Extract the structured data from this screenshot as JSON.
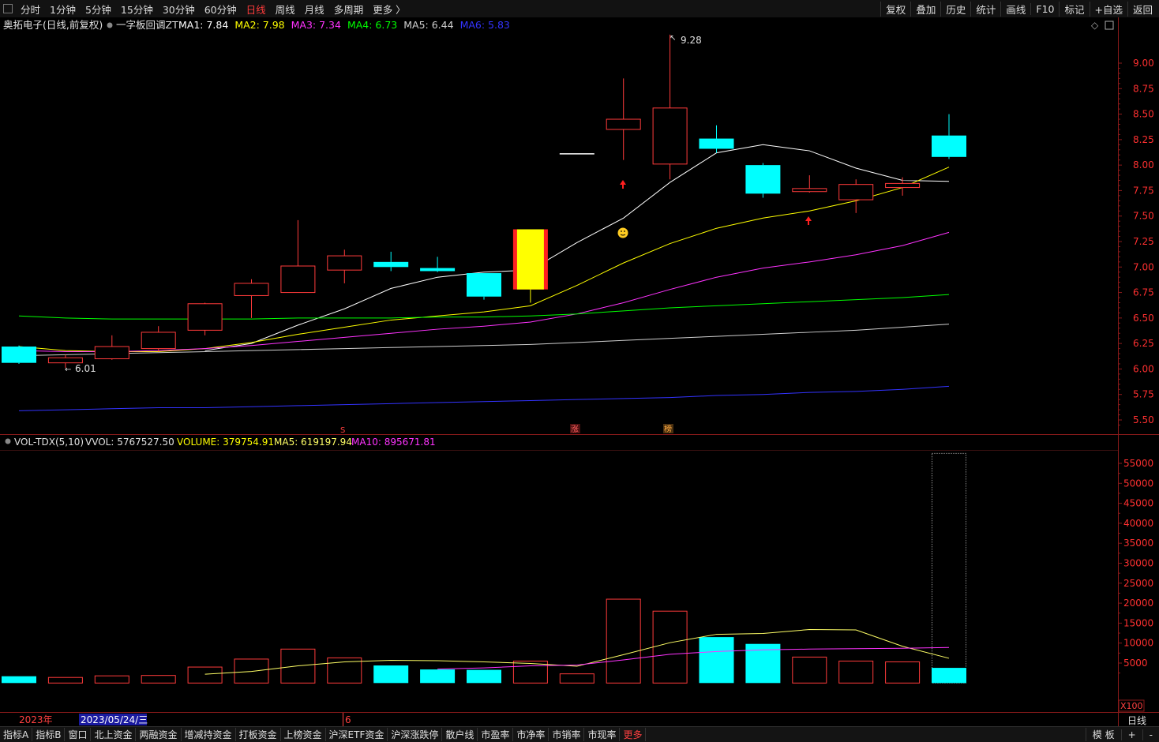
{
  "toolbar": {
    "periods": [
      "分时",
      "1分钟",
      "5分钟",
      "15分钟",
      "30分钟",
      "60分钟",
      "日线",
      "周线",
      "月线",
      "多周期",
      "更多 〉"
    ],
    "active_period": "日线",
    "right": [
      "复权",
      "叠加",
      "历史",
      "统计",
      "画线",
      "F10",
      "标记",
      "+自选",
      "返回"
    ]
  },
  "header": {
    "stock": "奥拓电子(日线,前复权)",
    "indicator": "一字板回调ZT",
    "ma": [
      {
        "label": "MA1: 7.84",
        "color": "#ffffff"
      },
      {
        "label": "MA2: 7.98",
        "color": "#ffff00"
      },
      {
        "label": "MA3: 7.34",
        "color": "#ff33ff"
      },
      {
        "label": "MA4: 6.73",
        "color": "#00ff00"
      },
      {
        "label": "MA5: 6.44",
        "color": "#cfcfcf"
      },
      {
        "label": "MA6: 5.83",
        "color": "#3333ff"
      }
    ]
  },
  "vol_header": {
    "name": "VOL-TDX(5,10)",
    "vvol": "VVOL: 5767527.50",
    "volume": "VOLUME: 379754.91",
    "ma5": "MA5: 619197.94",
    "ma10": "MA10: 895671.81"
  },
  "price_axis": [
    "9.00",
    "8.75",
    "8.50",
    "8.25",
    "8.00",
    "7.75",
    "7.50",
    "7.25",
    "7.00",
    "6.75",
    "6.50",
    "6.25",
    "6.00",
    "5.75",
    "5.50"
  ],
  "vol_axis": [
    "55000",
    "50000",
    "45000",
    "40000",
    "35000",
    "30000",
    "25000",
    "20000",
    "15000",
    "10000",
    "5000"
  ],
  "vol_unit": "X100",
  "period_label": "日线",
  "date_axis": {
    "year": "2023年",
    "cursor": "2023/05/24/三",
    "month": "6"
  },
  "annotations": {
    "high": "9.28",
    "low": "6.01",
    "marker_s": "S",
    "marker_zhang": "涨",
    "marker_bang": "榜"
  },
  "chart_data": {
    "type": "candlestick",
    "candles": [
      {
        "o": 6.22,
        "h": 6.23,
        "l": 6.05,
        "c": 6.06,
        "v": 1700
      },
      {
        "o": 6.06,
        "h": 6.14,
        "l": 6.01,
        "c": 6.11,
        "v": 1400
      },
      {
        "o": 6.1,
        "h": 6.33,
        "l": 6.09,
        "c": 6.22,
        "v": 1800
      },
      {
        "o": 6.2,
        "h": 6.42,
        "l": 6.17,
        "c": 6.36,
        "v": 1900
      },
      {
        "o": 6.38,
        "h": 6.65,
        "l": 6.33,
        "c": 6.64,
        "v": 4000
      },
      {
        "o": 6.72,
        "h": 6.88,
        "l": 6.5,
        "c": 6.84,
        "v": 6000
      },
      {
        "o": 6.75,
        "h": 7.46,
        "l": 6.75,
        "c": 7.01,
        "v": 8500
      },
      {
        "o": 6.97,
        "h": 7.17,
        "l": 6.84,
        "c": 7.11,
        "v": 6300
      },
      {
        "o": 7.05,
        "h": 7.15,
        "l": 6.96,
        "c": 7.0,
        "v": 4400
      },
      {
        "o": 6.99,
        "h": 7.1,
        "l": 6.95,
        "c": 6.96,
        "v": 3400
      },
      {
        "o": 6.94,
        "h": 6.94,
        "l": 6.68,
        "c": 6.71,
        "v": 3300
      },
      {
        "o": 6.78,
        "h": 7.37,
        "l": 6.65,
        "c": 7.37,
        "v": 5500,
        "limit": true
      },
      {
        "o": 8.11,
        "h": 8.11,
        "l": 8.11,
        "c": 8.11,
        "v": 2300
      },
      {
        "o": 8.35,
        "h": 8.85,
        "l": 8.05,
        "c": 8.45,
        "v": 21000
      },
      {
        "o": 8.01,
        "h": 9.28,
        "l": 7.86,
        "c": 8.56,
        "v": 18000
      },
      {
        "o": 8.26,
        "h": 8.39,
        "l": 8.12,
        "c": 8.16,
        "v": 11500
      },
      {
        "o": 8.0,
        "h": 8.02,
        "l": 7.68,
        "c": 7.72,
        "v": 9800
      },
      {
        "o": 7.74,
        "h": 7.9,
        "l": 7.73,
        "c": 7.77,
        "v": 6500
      },
      {
        "o": 7.66,
        "h": 7.86,
        "l": 7.53,
        "c": 7.81,
        "v": 5500
      },
      {
        "o": 7.78,
        "h": 7.88,
        "l": 7.7,
        "c": 7.82,
        "v": 5300
      },
      {
        "o": 8.29,
        "h": 8.5,
        "l": 8.06,
        "c": 8.08,
        "v": 3800,
        "vol_outline": 57500
      }
    ],
    "ma_lines": [
      {
        "name": "MA1",
        "color": "#ffffff",
        "values": [
          null,
          null,
          null,
          null,
          6.18,
          6.25,
          6.43,
          6.59,
          6.79,
          6.9,
          6.95,
          6.97,
          7.24,
          7.48,
          7.83,
          8.12,
          8.2,
          8.14,
          7.97,
          7.85,
          7.84
        ]
      },
      {
        "name": "MA2",
        "color": "#ffff00",
        "values": [
          6.22,
          6.18,
          6.17,
          6.17,
          6.2,
          6.26,
          6.34,
          6.41,
          6.48,
          6.52,
          6.56,
          6.62,
          6.82,
          7.04,
          7.23,
          7.38,
          7.48,
          7.55,
          7.65,
          7.78,
          7.98
        ]
      },
      {
        "name": "MA3",
        "color": "#ff33ff",
        "values": [
          6.18,
          6.17,
          6.17,
          6.18,
          6.2,
          6.23,
          6.27,
          6.31,
          6.35,
          6.39,
          6.42,
          6.46,
          6.54,
          6.65,
          6.78,
          6.9,
          6.99,
          7.05,
          7.12,
          7.21,
          7.34
        ]
      },
      {
        "name": "MA4",
        "color": "#00ff00",
        "values": [
          6.52,
          6.5,
          6.49,
          6.49,
          6.49,
          6.49,
          6.5,
          6.5,
          6.5,
          6.51,
          6.51,
          6.52,
          6.54,
          6.57,
          6.6,
          6.62,
          6.64,
          6.66,
          6.68,
          6.7,
          6.73
        ]
      },
      {
        "name": "MA5",
        "color": "#cfcfcf",
        "values": [
          6.13,
          6.14,
          6.15,
          6.16,
          6.17,
          6.18,
          6.19,
          6.2,
          6.21,
          6.22,
          6.23,
          6.24,
          6.26,
          6.28,
          6.3,
          6.32,
          6.34,
          6.36,
          6.38,
          6.41,
          6.44
        ]
      },
      {
        "name": "MA6",
        "color": "#3333ff",
        "values": [
          5.59,
          5.6,
          5.61,
          5.62,
          5.62,
          5.63,
          5.64,
          5.65,
          5.66,
          5.67,
          5.68,
          5.69,
          5.7,
          5.71,
          5.72,
          5.74,
          5.75,
          5.77,
          5.78,
          5.8,
          5.83
        ]
      }
    ],
    "vol_ma": [
      {
        "name": "MA5",
        "color": "#ffff66",
        "values": [
          null,
          null,
          null,
          null,
          2200,
          2900,
          4300,
          5300,
          5700,
          5600,
          5300,
          4900,
          4200,
          7100,
          10100,
          12200,
          12400,
          13400,
          13300,
          9200,
          6200
        ]
      },
      {
        "name": "MA10",
        "color": "#ff33ff",
        "values": [
          null,
          null,
          null,
          null,
          null,
          null,
          null,
          null,
          null,
          3500,
          3800,
          4300,
          4500,
          5800,
          7200,
          7900,
          8300,
          8500,
          8600,
          8700,
          8900
        ]
      }
    ],
    "price_range": [
      5.4,
      9.4
    ],
    "vol_range": [
      0,
      60000
    ]
  },
  "bottom": {
    "tabs": [
      "指标A",
      "指标B",
      "窗口",
      "北上资金",
      "两融资金",
      "增减持资金",
      "打板资金",
      "上榜资金",
      "沪深ETF资金",
      "沪深涨跌停",
      "散户线",
      "市盈率",
      "市净率",
      "市销率",
      "市现率",
      "更多"
    ],
    "right": [
      "模 板",
      "+",
      "-"
    ]
  }
}
